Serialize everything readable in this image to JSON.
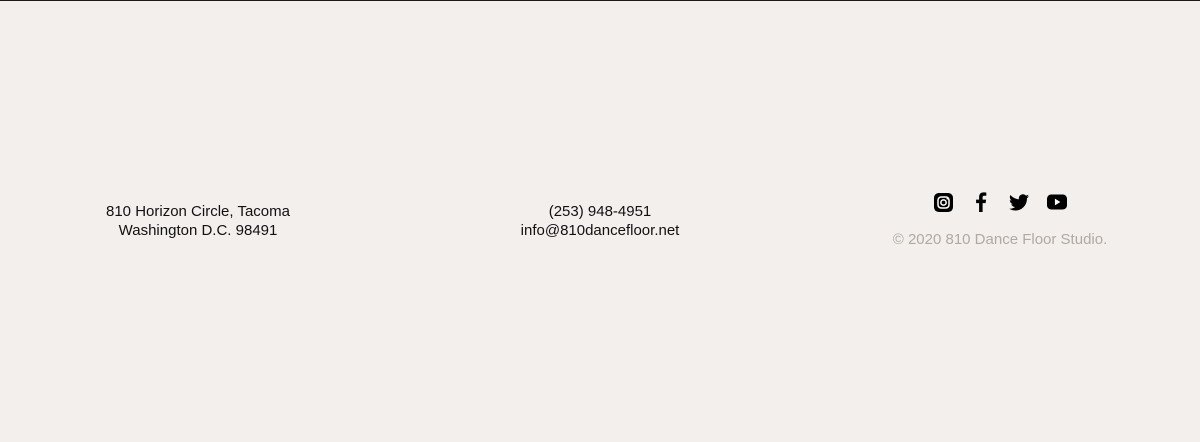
{
  "footer": {
    "address": {
      "line1": "810 Horizon Circle, Tacoma",
      "line2": "Washington D.C. 98491"
    },
    "contact": {
      "phone": "(253) 948-4951",
      "email": "info@810dancefloor.net"
    },
    "social": {
      "icons": [
        "instagram-icon",
        "facebook-icon",
        "twitter-icon",
        "youtube-icon"
      ]
    },
    "copyright": "© 2020 810 Dance Floor Studio."
  },
  "colors": {
    "background": "#f3efec",
    "text": "#111111",
    "muted": "#b1a9a2"
  }
}
